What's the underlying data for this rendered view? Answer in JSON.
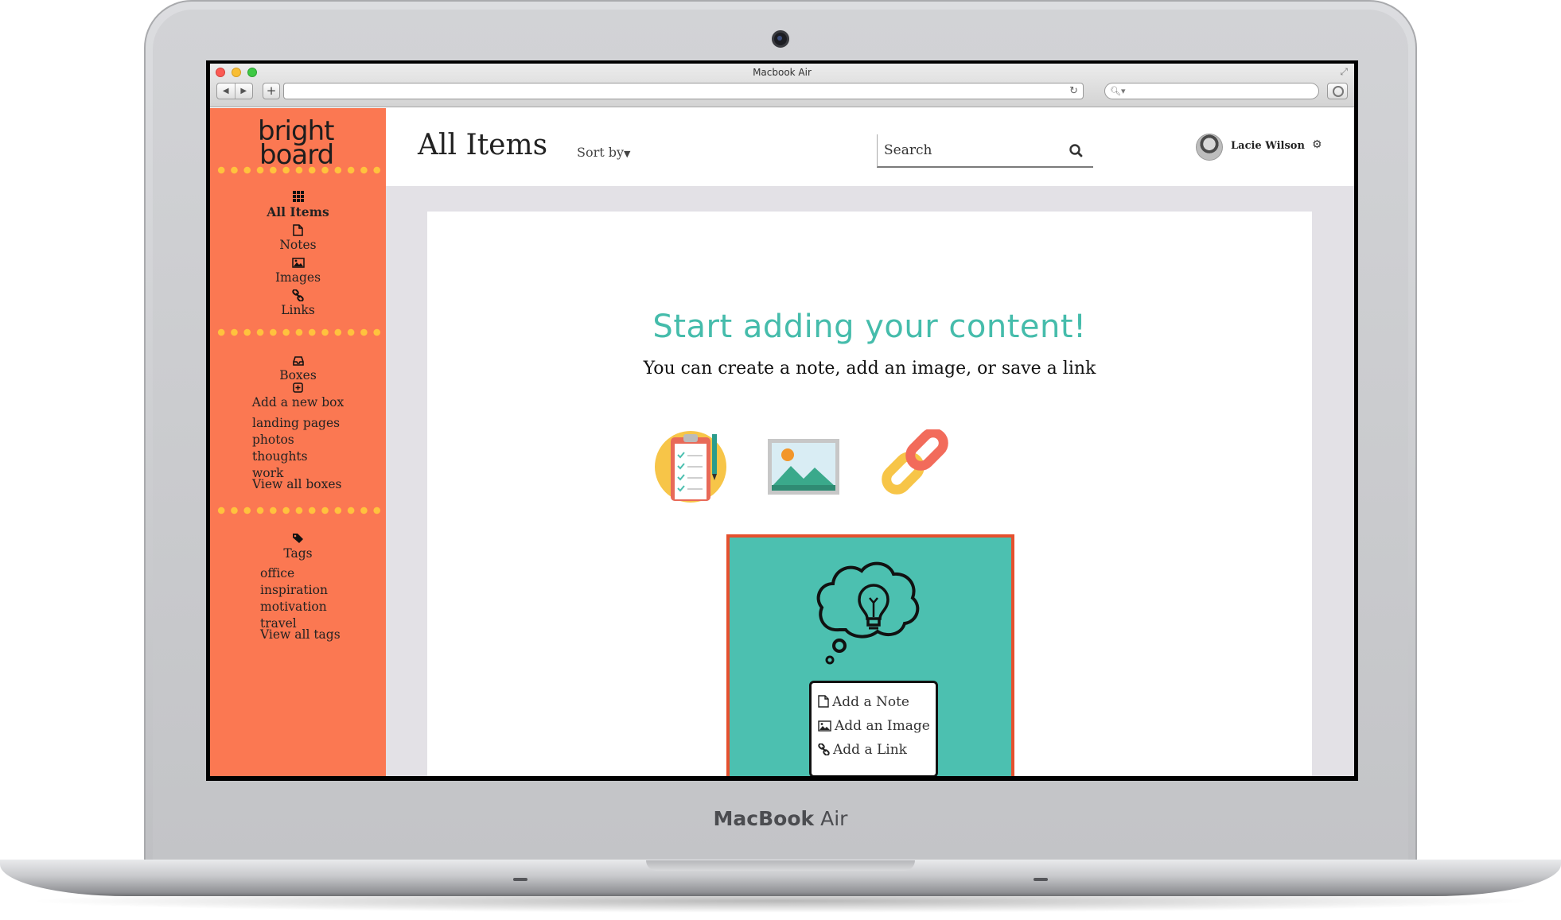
{
  "window": {
    "title": "Macbook Air"
  },
  "device": {
    "brand_bold": "MacBook",
    "brand_light": " Air"
  },
  "logo": {
    "line1": "bright",
    "line2": "board"
  },
  "sidebar": {
    "nav": [
      {
        "label": "All Items",
        "icon": "grid-icon",
        "active": true
      },
      {
        "label": "Notes",
        "icon": "file-icon"
      },
      {
        "label": "Images",
        "icon": "image-icon"
      },
      {
        "label": "Links",
        "icon": "link-icon"
      }
    ],
    "boxes": {
      "label": "Boxes",
      "icon": "inbox-icon",
      "add_label": "Add a new box",
      "add_icon": "plus-square-icon",
      "items": [
        "landing pages",
        "photos",
        "thoughts",
        "work"
      ],
      "view_all": "View all boxes"
    },
    "tags": {
      "label": "Tags",
      "icon": "tags-icon",
      "items": [
        "office",
        "inspiration",
        "motivation",
        "travel"
      ],
      "view_all": "View all tags"
    }
  },
  "header": {
    "title": "All Items",
    "sort_label": "Sort by",
    "search_placeholder": "Search",
    "user_name": "Lacie Wilson"
  },
  "empty_state": {
    "headline": "Start adding your content!",
    "subline": "You can create a note, add an image, or save a link",
    "icons": [
      "clipboard-icon",
      "picture-icon",
      "chain-link-icon"
    ]
  },
  "add_menu": {
    "items": [
      {
        "label": "Add a Note",
        "icon": "file-icon"
      },
      {
        "label": "Add an Image",
        "icon": "image-icon"
      },
      {
        "label": "Add a Link",
        "icon": "link-icon"
      }
    ]
  },
  "colors": {
    "sidebar": "#fb7852",
    "dots": "#ffc23d",
    "accent": "#45bcab",
    "promo_bg": "#4cc0b0",
    "promo_border": "#e5502e",
    "content_bg": "#e3e1e6"
  }
}
